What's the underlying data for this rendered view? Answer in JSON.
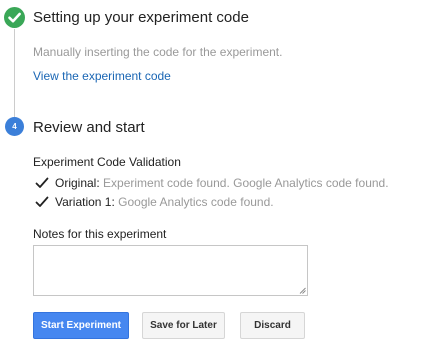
{
  "step1": {
    "status_icon": "check-icon",
    "title": "Setting up your experiment code",
    "description": "Manually inserting the code for the experiment.",
    "link_label": "View the experiment code"
  },
  "step2": {
    "number": "4",
    "title": "Review and start",
    "validation_heading": "Experiment Code Validation",
    "validation_rows": [
      {
        "icon": "checkmark-icon",
        "label": "Original:",
        "status": "Experiment code found. Google Analytics code found."
      },
      {
        "icon": "checkmark-icon",
        "label": "Variation 1:",
        "status": "Google Analytics code found."
      }
    ],
    "notes_label": "Notes for this experiment",
    "notes_value": ""
  },
  "buttons": {
    "start_label": "Start Experiment",
    "save_label": "Save for Later",
    "discard_label": "Discard"
  },
  "colors": {
    "complete_green": "#3aa757",
    "step_blue": "#3b7fd9",
    "link_blue": "#1a66b4",
    "primary_button": "#4687f0",
    "muted_text": "#999999"
  }
}
